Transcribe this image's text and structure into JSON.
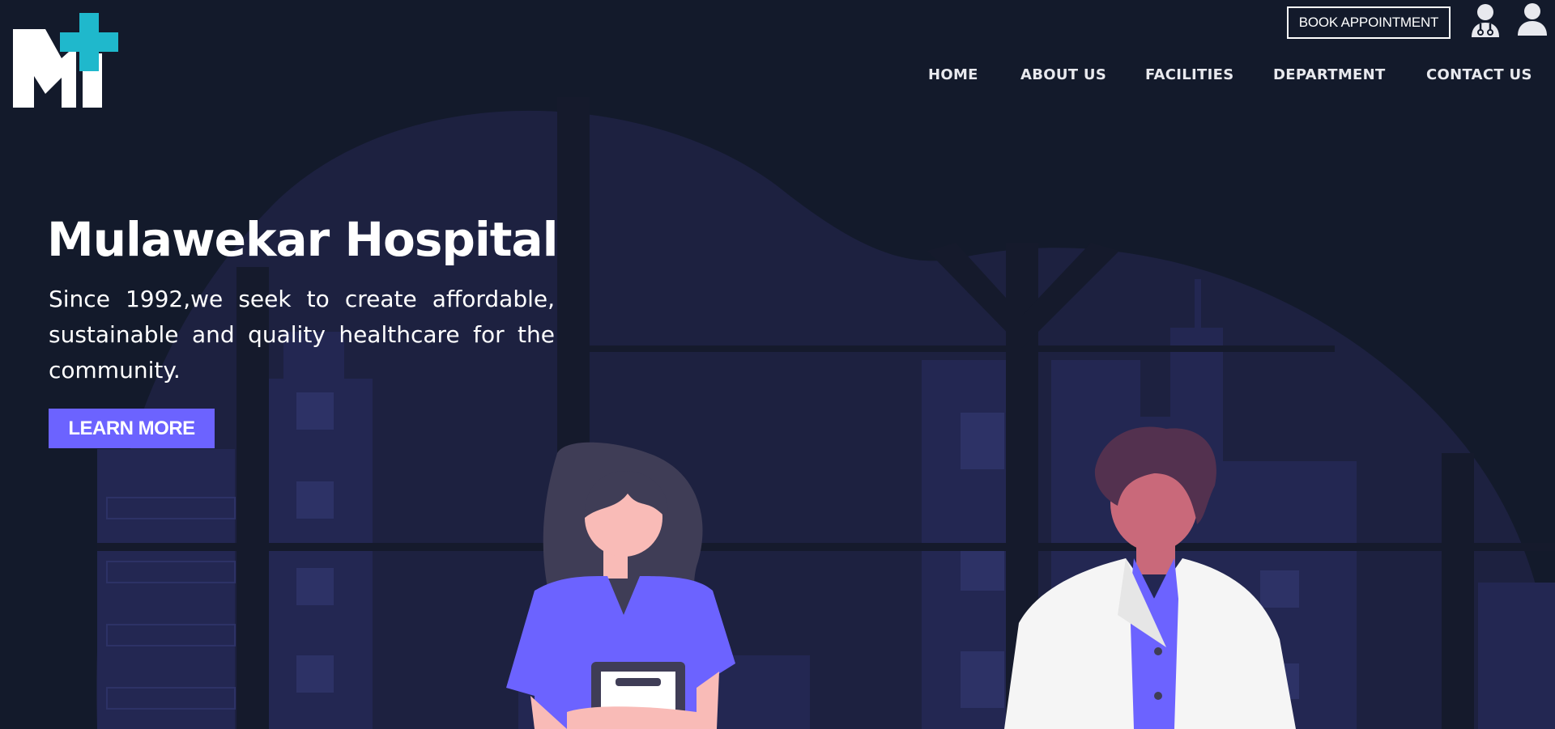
{
  "header": {
    "book_appointment": "BOOK APPOINTMENT",
    "icons": [
      "doctor-icon",
      "user-icon"
    ]
  },
  "nav": {
    "items": [
      "HOME",
      "ABOUT US",
      "FACILITIES",
      "DEPARTMENT",
      "CONTACT US"
    ]
  },
  "hero": {
    "title": "Mulawekar Hospital",
    "text": "Since 1992,we seek to create affordable, sustainable and quality healthcare for the community.",
    "cta": "LEARN MORE"
  },
  "colors": {
    "background": "#131a2b",
    "accent": "#6c63ff",
    "logo_cross": "#1fb8cc",
    "illustration": "#1d2140"
  }
}
